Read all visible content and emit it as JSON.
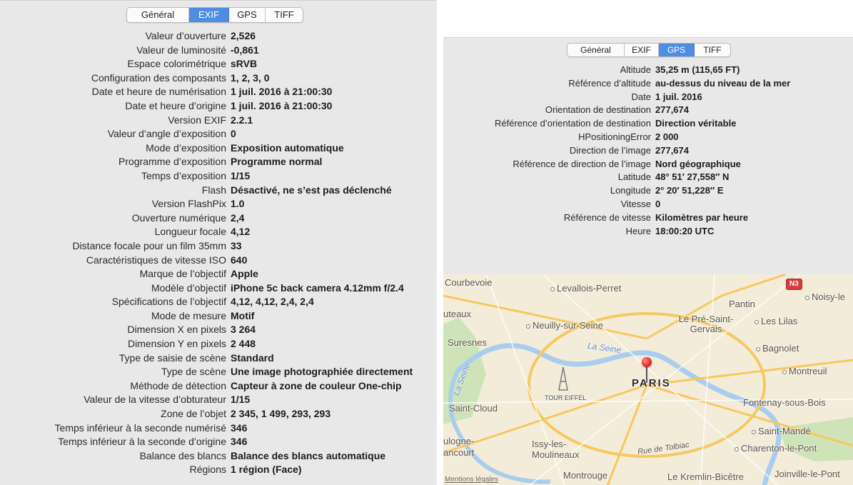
{
  "exif_panel": {
    "tabs": [
      {
        "label": "Général"
      },
      {
        "label": "EXIF"
      },
      {
        "label": "GPS"
      },
      {
        "label": "TIFF"
      }
    ],
    "active_tab": "EXIF",
    "rows": [
      {
        "label": "Valeur d’ouverture",
        "value": "2,526"
      },
      {
        "label": "Valeur de luminosité",
        "value": "-0,861"
      },
      {
        "label": "Espace colorimétrique",
        "value": "sRVB"
      },
      {
        "label": "Configuration des composants",
        "value": "1, 2, 3, 0"
      },
      {
        "label": "Date et heure de numérisation",
        "value": "1 juil. 2016 à 21:00:30"
      },
      {
        "label": "Date et heure d’origine",
        "value": "1 juil. 2016 à 21:00:30"
      },
      {
        "label": "Version EXIF",
        "value": "2.2.1"
      },
      {
        "label": "Valeur d’angle d’exposition",
        "value": "0"
      },
      {
        "label": "Mode d’exposition",
        "value": "Exposition automatique"
      },
      {
        "label": "Programme d’exposition",
        "value": "Programme normal"
      },
      {
        "label": "Temps d’exposition",
        "value": "1/15"
      },
      {
        "label": "Flash",
        "value": "Désactivé, ne s’est pas déclenché"
      },
      {
        "label": "Version FlashPix",
        "value": "1.0"
      },
      {
        "label": "Ouverture numérique",
        "value": "2,4"
      },
      {
        "label": "Longueur focale",
        "value": "4,12"
      },
      {
        "label": "Distance focale pour un film 35mm",
        "value": "33"
      },
      {
        "label": "Caractéristiques de vitesse ISO",
        "value": "640"
      },
      {
        "label": "Marque de l’objectif",
        "value": "Apple"
      },
      {
        "label": "Modèle d’objectif",
        "value": "iPhone 5c back camera 4.12mm f/2.4"
      },
      {
        "label": "Spécifications de l’objectif",
        "value": "4,12, 4,12, 2,4, 2,4"
      },
      {
        "label": "Mode de mesure",
        "value": "Motif"
      },
      {
        "label": "Dimension X en pixels",
        "value": "3 264"
      },
      {
        "label": "Dimension Y en pixels",
        "value": "2 448"
      },
      {
        "label": "Type de saisie de scène",
        "value": "Standard"
      },
      {
        "label": "Type de scène",
        "value": "Une image photographiée directement"
      },
      {
        "label": "Méthode de détection",
        "value": "Capteur à zone de couleur One-chip"
      },
      {
        "label": "Valeur de la vitesse d’obturateur",
        "value": "1/15"
      },
      {
        "label": "Zone de l’objet",
        "value": "2 345, 1 499, 293, 293"
      },
      {
        "label": "Temps inférieur à la seconde numérisé",
        "value": "346"
      },
      {
        "label": "Temps inférieur à la seconde d’origine",
        "value": "346"
      },
      {
        "label": "Balance des blancs",
        "value": "Balance des blancs automatique"
      },
      {
        "label": "Régions",
        "value": "1 région (Face)"
      }
    ]
  },
  "gps_panel": {
    "tabs": [
      {
        "label": "Général"
      },
      {
        "label": "EXIF"
      },
      {
        "label": "GPS"
      },
      {
        "label": "TIFF"
      }
    ],
    "active_tab": "GPS",
    "rows": [
      {
        "label": "Altitude",
        "value": "35,25 m (115,65 FT)"
      },
      {
        "label": "Référence d’altitude",
        "value": "au-dessus du niveau de la mer"
      },
      {
        "label": "Date",
        "value": "1 juil. 2016"
      },
      {
        "label": "Orientation de destination",
        "value": "277,674"
      },
      {
        "label": "Référence d’orientation de destination",
        "value": "Direction véritable"
      },
      {
        "label": "HPositioningError",
        "value": "2 000"
      },
      {
        "label": "Direction de l’image",
        "value": "277,674"
      },
      {
        "label": "Référence de direction de l’image",
        "value": "Nord géographique"
      },
      {
        "label": "Latitude",
        "value": "48° 51′ 27,558″ N"
      },
      {
        "label": "Longitude",
        "value": "2° 20′ 51,228″ E"
      },
      {
        "label": "Vitesse",
        "value": "0"
      },
      {
        "label": "Référence de vitesse",
        "value": "Kilomètres par heure"
      },
      {
        "label": "Heure",
        "value": "18:00:20 UTC"
      }
    ]
  },
  "map": {
    "labels": {
      "courbevoie": "Courbevoie",
      "levallois": "Levallois-Perret",
      "pantin": "Pantin",
      "noisy": "Noisy-le",
      "puteaux": "uteaux",
      "neuilly": "Neuilly-sur-Seine",
      "pre_saint_gervais": "Le Pré-Saint-Gervais",
      "les_lilas": "Les Lilas",
      "suresnes": "Suresnes",
      "bagnolet": "Bagnolet",
      "la_seine": "La Seine",
      "la_seine_left": "La Seine",
      "paris": "PARIS",
      "montreuil": "Montreuil",
      "tour_eiffel": "TOUR EIFFEL",
      "saint_cloud": "Saint-Cloud",
      "fontenay": "Fontenay-sous-Bois",
      "saint_mande": "Saint-Mandé",
      "boulogne": "ulogne-",
      "billancourt": "ancourt",
      "issy": "Issy-les-Moulineaux",
      "rue_tolbiac": "Rue de Tolbiac",
      "charenton": "Charenton-le-Pont",
      "montrouge": "Montrouge",
      "kremlin": "Le Kremlin-Bicêtre",
      "joinville": "Joinville-le-Pont",
      "legal": "Mentions légales",
      "road_n3": "N3"
    },
    "colors": {
      "land": "#f3ecd9",
      "water": "#a9cdee",
      "major_road": "#f6c860",
      "pin": "#e12b25"
    }
  }
}
